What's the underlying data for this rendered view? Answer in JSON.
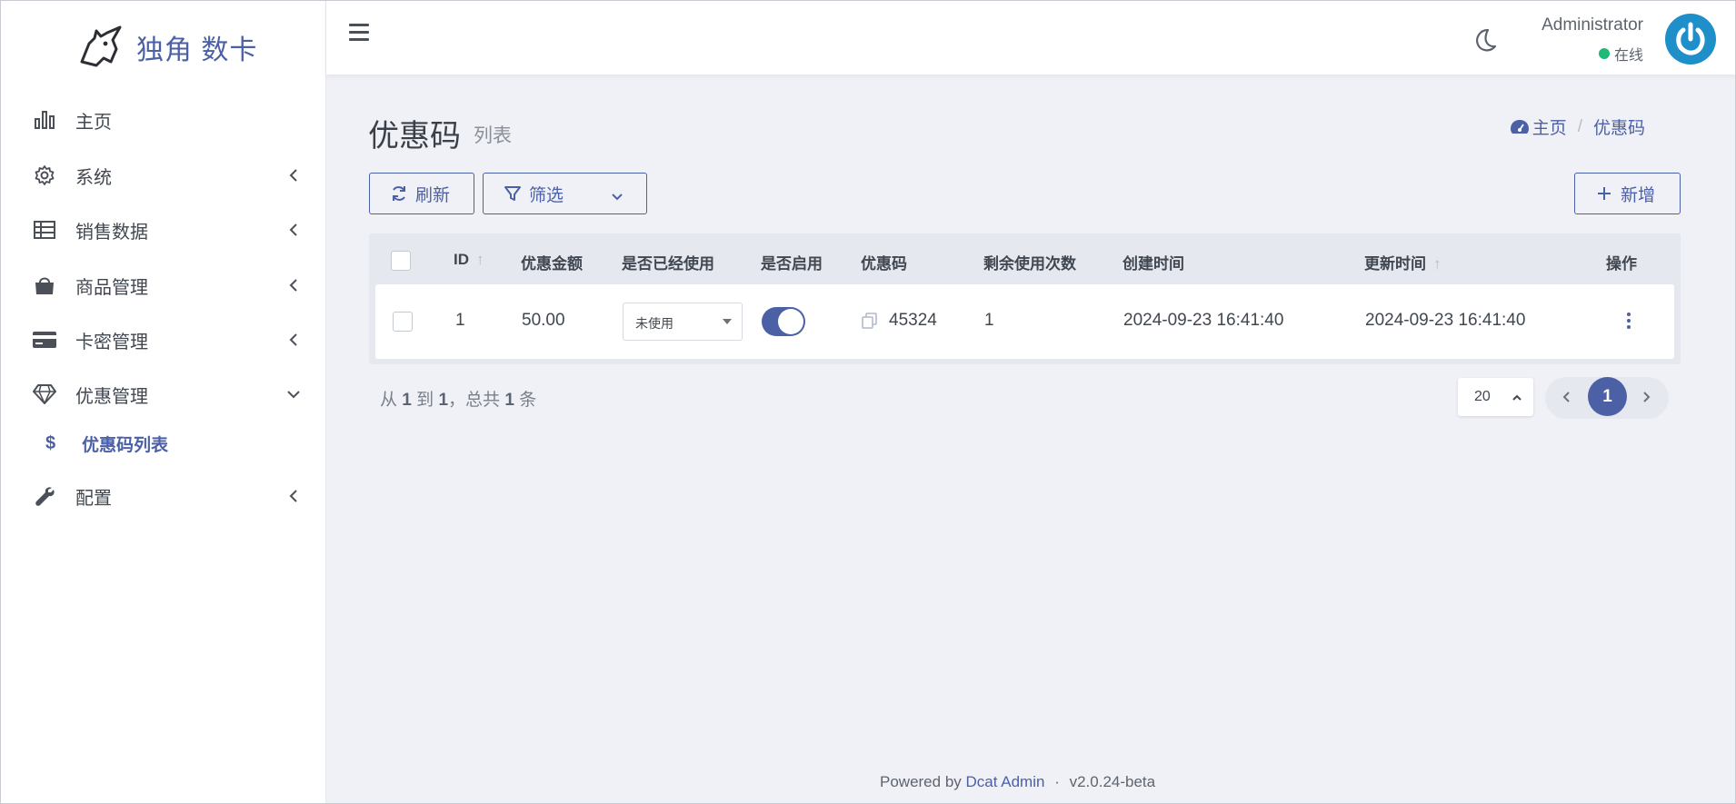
{
  "brand": {
    "name": "独角 数卡",
    "logo_icon": "unicorn-icon"
  },
  "sidebar": {
    "items": [
      {
        "label": "主页",
        "icon": "bar-chart-icon",
        "has_arrow": false
      },
      {
        "label": "系统",
        "icon": "gear-icon",
        "has_arrow": true
      },
      {
        "label": "销售数据",
        "icon": "table-icon",
        "has_arrow": true
      },
      {
        "label": "商品管理",
        "icon": "shopping-bag-icon",
        "has_arrow": true
      },
      {
        "label": "卡密管理",
        "icon": "credit-card-icon",
        "has_arrow": true
      },
      {
        "label": "优惠管理",
        "icon": "diamond-icon",
        "has_arrow": true,
        "expanded": true
      },
      {
        "label": "配置",
        "icon": "wrench-icon",
        "has_arrow": true
      }
    ],
    "sub_items": [
      {
        "label": "优惠码列表",
        "icon": "$",
        "active": true
      }
    ]
  },
  "topbar": {
    "user_name": "Administrator",
    "user_status": "在线",
    "status_color": "#21b978"
  },
  "page": {
    "title": "优惠码",
    "subtitle": "列表",
    "breadcrumb": {
      "home": "主页",
      "current": "优惠码"
    }
  },
  "toolbar": {
    "refresh_label": "刷新",
    "filter_label": "筛选",
    "add_label": "新增"
  },
  "table": {
    "columns": [
      "ID",
      "优惠金额",
      "是否已经使用",
      "是否启用",
      "优惠码",
      "剩余使用次数",
      "创建时间",
      "更新时间",
      "操作"
    ],
    "rows": [
      {
        "id": "1",
        "amount": "50.00",
        "used_status": "未使用",
        "enabled": true,
        "code": "45324",
        "remaining": "1",
        "created_at": "2024-09-23 16:41:40",
        "updated_at": "2024-09-23 16:41:40"
      }
    ]
  },
  "pagination": {
    "summary_from_label": "从",
    "from": "1",
    "summary_to_label": "到",
    "to": "1",
    "summary_total_label": "，总共",
    "total": "1",
    "summary_unit": "条",
    "per_page": "20",
    "current_page": "1"
  },
  "footer": {
    "powered_by": "Powered by",
    "link": "Dcat Admin",
    "separator": "·",
    "version": "v2.0.24-beta"
  },
  "colors": {
    "accent": "#4c60a6",
    "background": "#f0f1f7",
    "avatar": "#1f8fca"
  }
}
